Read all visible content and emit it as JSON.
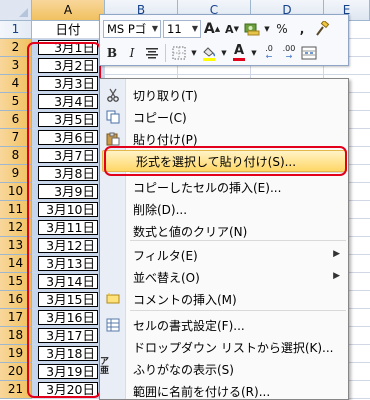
{
  "columns": [
    "A",
    "B",
    "C",
    "D",
    "E"
  ],
  "rows": [
    "1",
    "2",
    "3",
    "4",
    "5",
    "6",
    "7",
    "8",
    "9",
    "10",
    "11",
    "12",
    "13",
    "14",
    "15",
    "16",
    "17",
    "18",
    "19",
    "20",
    "21"
  ],
  "column_a": {
    "header": "日付",
    "values": [
      "3月1日",
      "3月2日",
      "3月3日",
      "3月4日",
      "3月5日",
      "3月6日",
      "3月7日",
      "3月8日",
      "3月9日",
      "3月10日",
      "3月11日",
      "3月12日",
      "3月13日",
      "3月14日",
      "3月15日",
      "3月16日",
      "3月17日",
      "3月18日",
      "3月19日",
      "3月20日"
    ]
  },
  "mini_toolbar": {
    "font_name": "MS Pゴ",
    "font_size": "11",
    "grow_font": "A",
    "shrink_font": "A",
    "percent": "%",
    "comma": ",",
    "bold": "B",
    "italic": "I",
    "font_color_letter": "A",
    "font_color": "#e3001b",
    "fill_color": "#ffff00",
    "increase_decimal": ".0",
    "decrease_decimal": ".00"
  },
  "context_menu": {
    "items": [
      {
        "label": "切り取り(T)",
        "icon": "scissors-icon"
      },
      {
        "label": "コピー(C)",
        "icon": "copy-icon"
      },
      {
        "label": "貼り付け(P)",
        "icon": "paste-icon"
      },
      {
        "label": "形式を選択して貼り付け(S)...",
        "icon": ""
      },
      {
        "label": "コピーしたセルの挿入(E)...",
        "icon": ""
      },
      {
        "label": "削除(D)...",
        "icon": ""
      },
      {
        "label": "数式と値のクリア(N)",
        "icon": ""
      },
      {
        "label": "フィルタ(E)",
        "icon": "",
        "submenu": true
      },
      {
        "label": "並べ替え(O)",
        "icon": "",
        "submenu": true
      },
      {
        "label": "コメントの挿入(M)",
        "icon": "comment-icon"
      },
      {
        "label": "セルの書式設定(F)...",
        "icon": "format-cells-icon"
      },
      {
        "label": "ドロップダウン リストから選択(K)...",
        "icon": ""
      },
      {
        "label": "ふりがなの表示(S)",
        "icon": "phonetic-icon"
      },
      {
        "label": "範囲に名前を付ける(R)...",
        "icon": ""
      }
    ],
    "side_label": "ア亜"
  },
  "colors": {
    "highlight": "#e3001b",
    "selection": "#c5d5ee",
    "menu_hover": "#ffd767"
  }
}
